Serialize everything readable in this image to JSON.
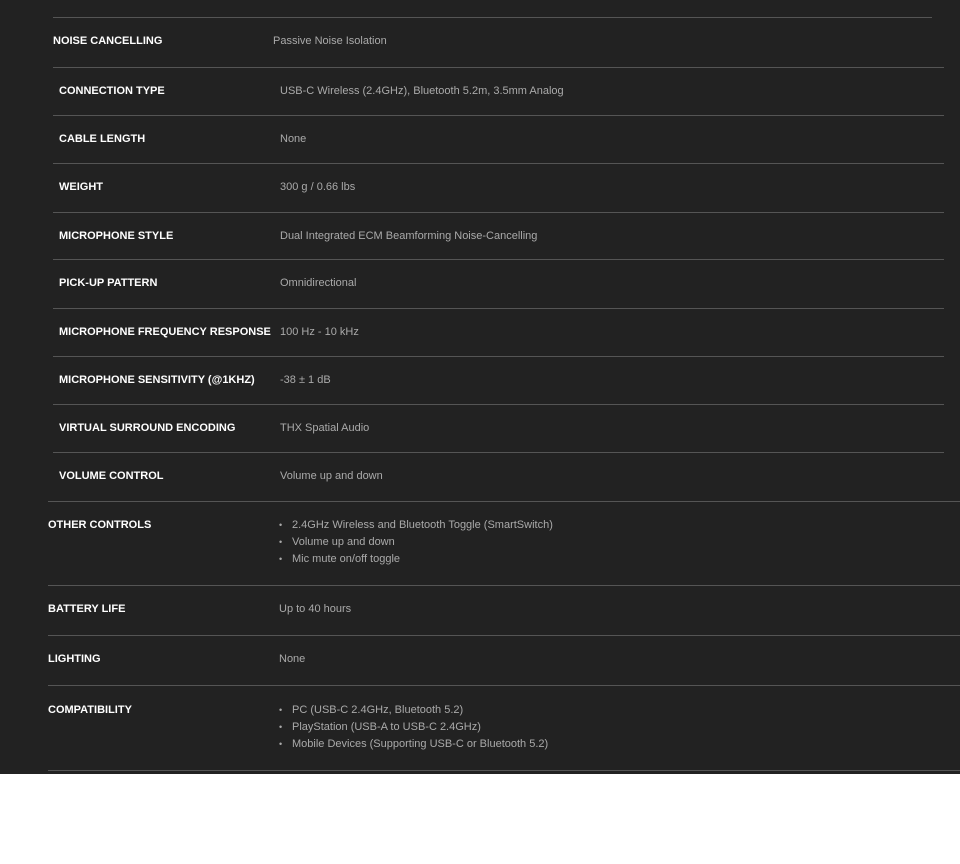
{
  "specs": [
    {
      "label": "NOISE CANCELLING",
      "value": "Passive Noise Isolation"
    },
    {
      "label": "CONNECTION TYPE",
      "value": "USB-C Wireless (2.4GHz), Bluetooth 5.2m, 3.5mm Analog"
    },
    {
      "label": "CABLE LENGTH",
      "value": "None"
    },
    {
      "label": "WEIGHT",
      "value": "300 g / 0.66 lbs"
    },
    {
      "label": "MICROPHONE STYLE",
      "value": "Dual Integrated ECM Beamforming Noise-Cancelling"
    },
    {
      "label": "PICK-UP PATTERN",
      "value": "Omnidirectional"
    },
    {
      "label": "MICROPHONE FREQUENCY RESPONSE",
      "value": "100 Hz - 10 kHz"
    },
    {
      "label": "MICROPHONE SENSITIVITY (@1KHZ)",
      "value": "-38 ± 1 dB"
    },
    {
      "label": "VIRTUAL SURROUND ENCODING",
      "value": "THX Spatial Audio"
    },
    {
      "label": "VOLUME CONTROL",
      "value": "Volume up and down"
    },
    {
      "label": "OTHER CONTROLS",
      "items": [
        "2.4GHz Wireless and Bluetooth Toggle (SmartSwitch)",
        "Volume up and down",
        "Mic mute on/off toggle"
      ]
    },
    {
      "label": "BATTERY LIFE",
      "value": "Up to 40 hours"
    },
    {
      "label": "LIGHTING",
      "value": "None"
    },
    {
      "label": "COMPATIBILITY",
      "items": [
        "PC (USB-C 2.4GHz, Bluetooth 5.2)",
        "PlayStation (USB-A to USB-C 2.4GHz)",
        "Mobile Devices (Supporting USB-C or Bluetooth 5.2)"
      ]
    }
  ],
  "colors": {
    "background": "#222222",
    "label": "#ffffff",
    "value": "#aaaaaa",
    "divider": "#555555",
    "page": "#ffffff"
  }
}
